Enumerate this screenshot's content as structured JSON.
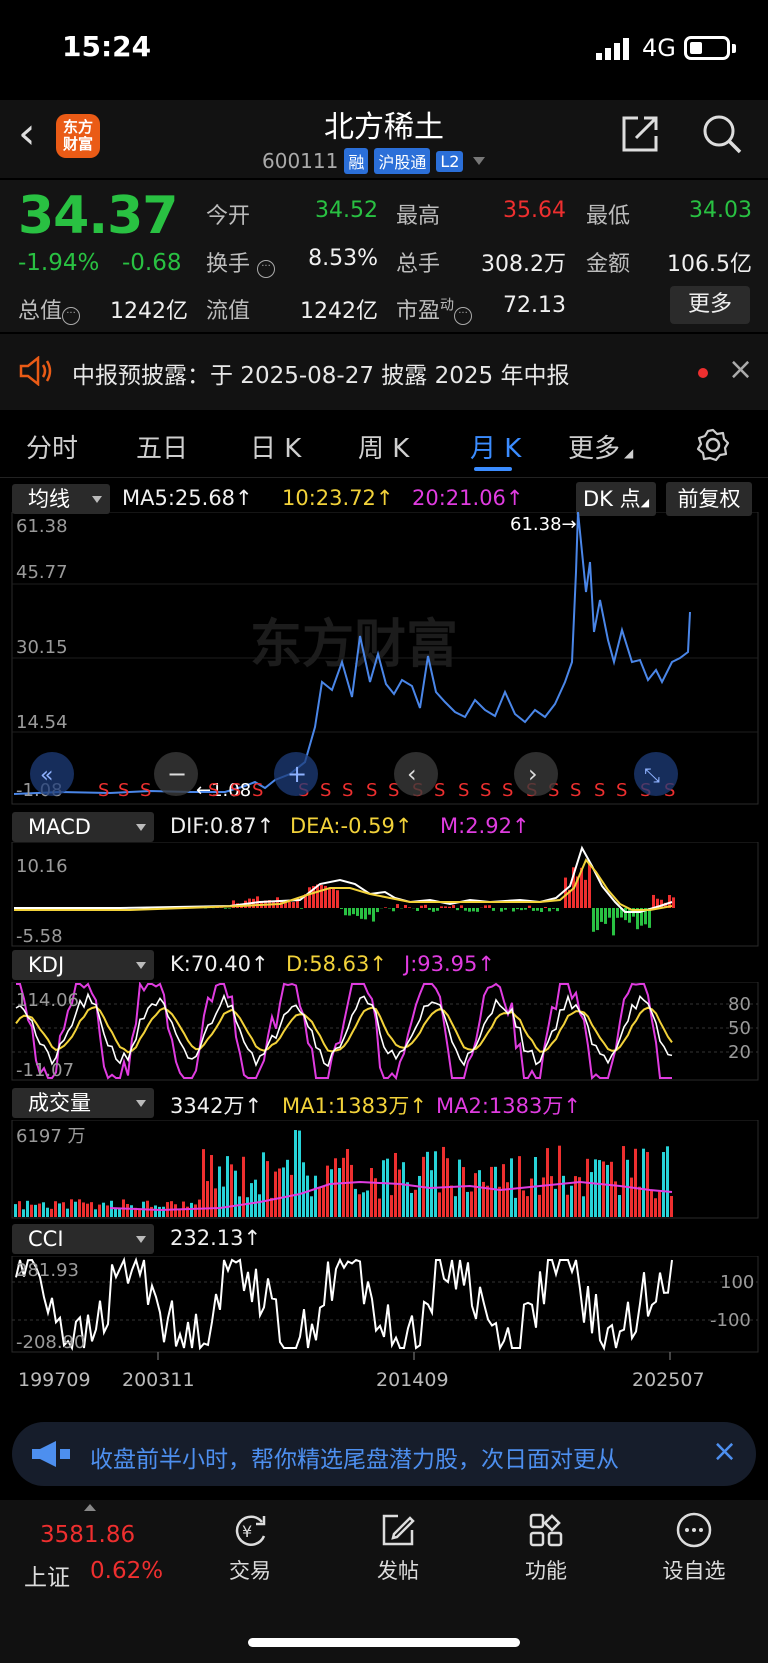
{
  "status_bar": {
    "time": "15:24",
    "network": "4G"
  },
  "header": {
    "title": "北方稀土",
    "code": "600111",
    "logo_text": [
      "东方",
      "财富"
    ],
    "tags": [
      "融",
      "沪股通",
      "L2"
    ]
  },
  "quote": {
    "price": "34.37",
    "change_pct": "-1.94%",
    "change": "-0.68",
    "fields": [
      {
        "label": "今开",
        "value": "34.52",
        "color": "#29c142"
      },
      {
        "label": "最高",
        "value": "35.64",
        "color": "#ee2f2f"
      },
      {
        "label": "最低",
        "value": "34.03",
        "color": "#29c142"
      },
      {
        "label": "换手",
        "value": "8.53%",
        "color": "#f0f0f0"
      },
      {
        "label": "总手",
        "value": "308.2万",
        "color": "#f0f0f0"
      },
      {
        "label": "金额",
        "value": "106.5亿",
        "color": "#f0f0f0"
      },
      {
        "label": "总值",
        "value": "1242亿",
        "color": "#f0f0f0"
      },
      {
        "label": "流值",
        "value": "1242亿",
        "color": "#f0f0f0"
      },
      {
        "label": "市盈",
        "superscript": "动",
        "value": "72.13",
        "color": "#f0f0f0"
      }
    ],
    "more_label": "更多"
  },
  "notice": {
    "text": "中报预披露：于 2025-08-27 披露 2025 年中报"
  },
  "tabs": [
    {
      "label": "分时"
    },
    {
      "label": "五日"
    },
    {
      "label": "日 K"
    },
    {
      "label": "周 K"
    },
    {
      "label": "月 K",
      "active": true
    },
    {
      "label": "更多"
    }
  ],
  "ma_panel": {
    "selector": "均线",
    "ma5": "MA5:25.68",
    "ma10": "10:23.72",
    "ma20": "20:21.06",
    "dk_button": "DK 点",
    "fq_button": "前复权",
    "y_labels": [
      "61.38",
      "45.77",
      "30.15",
      "14.54",
      "-1.08"
    ],
    "high_annotation": "61.38",
    "low_annotation": "1.08",
    "watermark": "东方财富",
    "signal_letter": "S"
  },
  "macd_panel": {
    "selector": "MACD",
    "dif": "DIF:0.87",
    "dea": "DEA:-0.59",
    "m": "M:2.92",
    "y_labels": [
      "10.16",
      "-5.58"
    ]
  },
  "kdj_panel": {
    "selector": "KDJ",
    "k": "K:70.40",
    "d": "D:58.63",
    "j": "J:93.95",
    "y_labels": [
      "114.06",
      "-11.07"
    ],
    "right_labels": [
      "80",
      "50",
      "20"
    ]
  },
  "vol_panel": {
    "selector": "成交量",
    "vol": "3342万",
    "ma1": "MA1:1383万",
    "ma2": "MA2:1383万",
    "y_label": "6197 万"
  },
  "cci_panel": {
    "selector": "CCI",
    "cci": "232.13",
    "y_labels": [
      "281.93",
      "-208.90"
    ],
    "right_labels": [
      "100",
      "-100"
    ]
  },
  "x_axis": [
    "199709",
    "200311",
    "201409",
    "202507"
  ],
  "chart_data": {
    "type": "line",
    "title": "月K",
    "price_series": {
      "name": "北方稀土 月K (前复权)",
      "y_range": [
        -1.08,
        61.38
      ],
      "high": 61.38,
      "low": 1.08,
      "last": 34.37
    },
    "macd": {
      "dif": 0.87,
      "dea": -0.59,
      "m": 2.92,
      "range": [
        -5.58,
        10.16
      ]
    },
    "kdj": {
      "k": 70.4,
      "d": 58.63,
      "j": 93.95,
      "range": [
        -11.07,
        114.06
      ]
    },
    "volume": {
      "last": "3342万",
      "ma1": "1383万",
      "ma2": "1383万",
      "max": "6197万"
    },
    "cci": {
      "value": 232.13,
      "range": [
        -208.9,
        281.93
      ]
    },
    "x_ticks": [
      "199709",
      "200311",
      "201409",
      "202507"
    ]
  },
  "ad_banner": {
    "text": "收盘前半小时，帮你精选尾盘潜力股，次日面对更从"
  },
  "bottom_nav": {
    "index_value": "3581.86",
    "index_name": "上证",
    "index_change": "0.62%",
    "items": [
      {
        "label": "交易"
      },
      {
        "label": "发帖"
      },
      {
        "label": "功能"
      },
      {
        "label": "设自选"
      }
    ]
  },
  "colors": {
    "up": "#ee2f2f",
    "down": "#29c142",
    "accent": "#3b8cff",
    "yellow": "#f2d23a",
    "magenta": "#e03ce0"
  }
}
